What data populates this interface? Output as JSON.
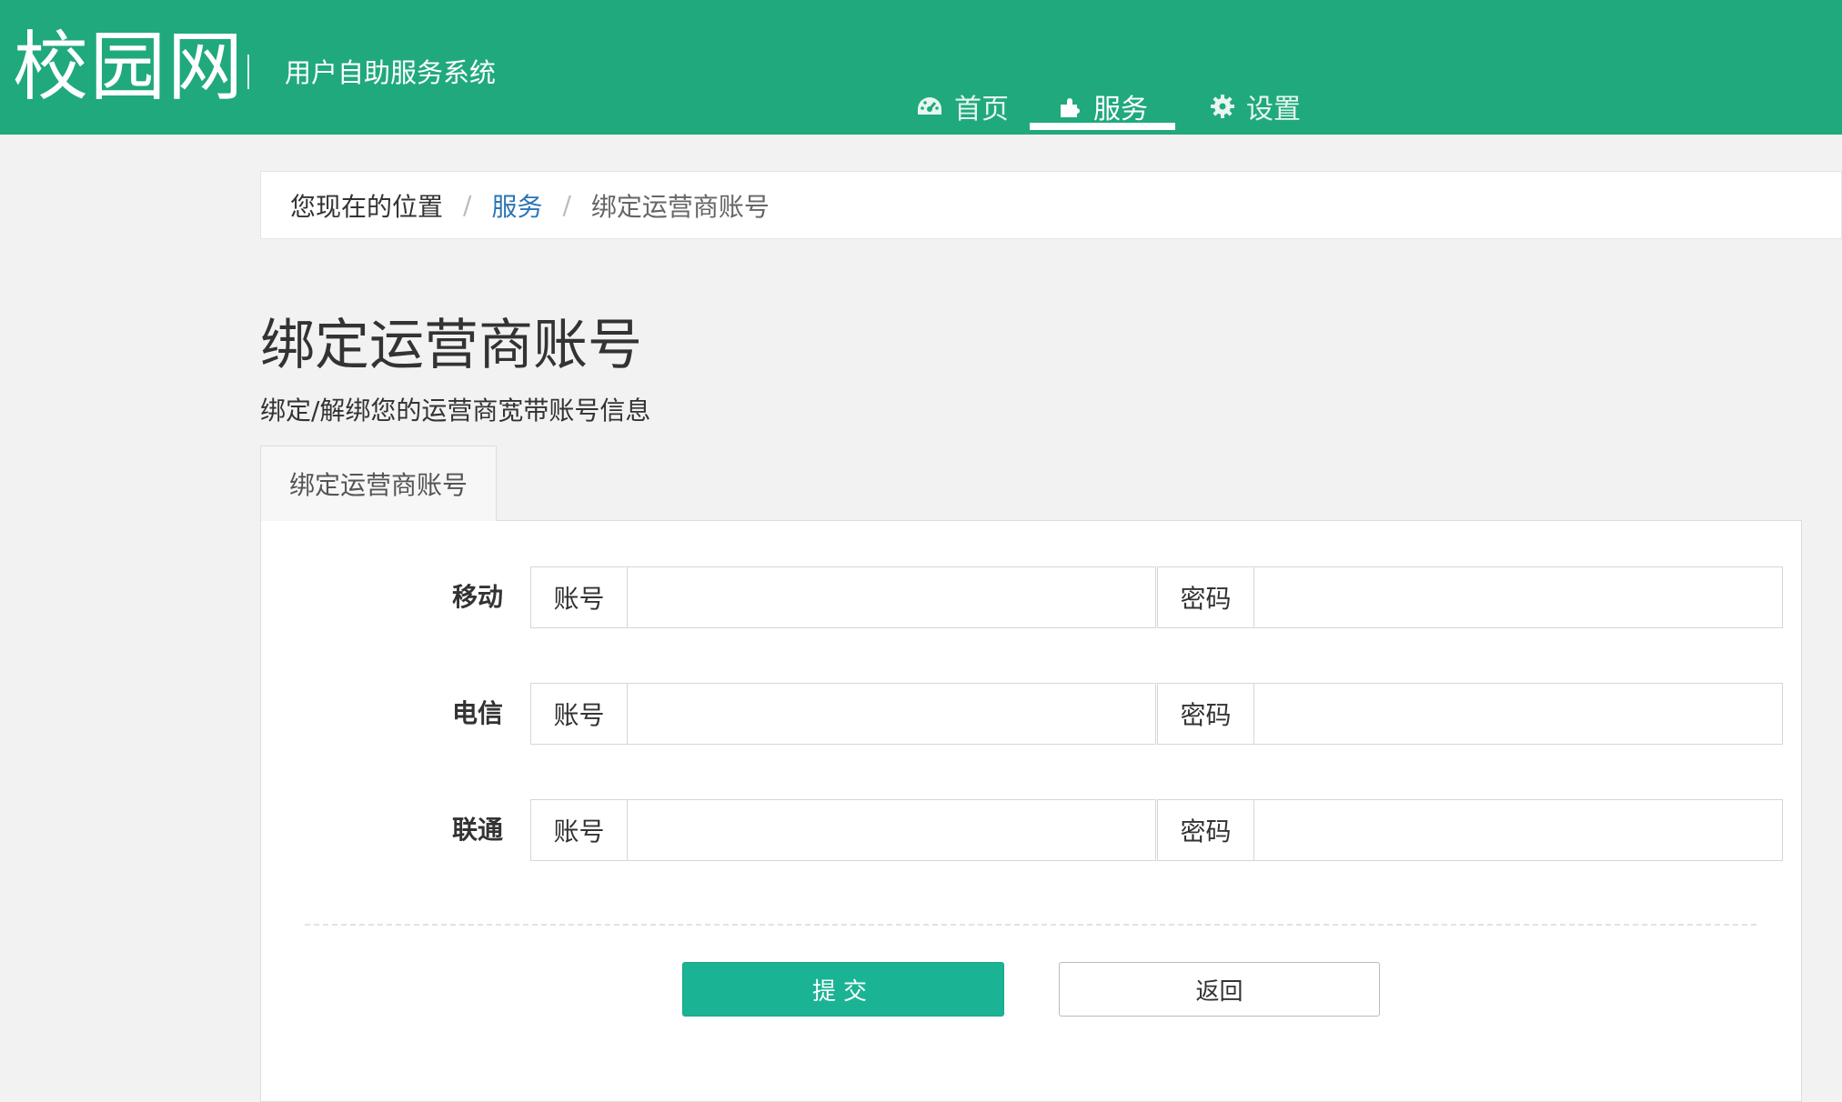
{
  "header": {
    "logo": "校园网",
    "subtitle": "用户自助服务系统",
    "nav": [
      {
        "label": "首页",
        "icon": "dashboard-icon"
      },
      {
        "label": "服务",
        "icon": "puzzle-icon"
      },
      {
        "label": "设置",
        "icon": "gear-icon"
      }
    ],
    "active_nav": "服务",
    "colors": {
      "header_bg": "#20a97d",
      "primary_button": "#1ab394",
      "link": "#2a74b5"
    }
  },
  "breadcrumb": {
    "prefix": "您现在的位置",
    "separator": "/",
    "link": "服务",
    "current": "绑定运营商账号"
  },
  "page": {
    "title": "绑定运营商账号",
    "description": "绑定/解绑您的运营商宽带账号信息"
  },
  "tab": {
    "label": "绑定运营商账号"
  },
  "form": {
    "rows": [
      {
        "label": "移动",
        "account_addon": "账号",
        "password_addon": "密码",
        "account_value": "",
        "password_value": ""
      },
      {
        "label": "电信",
        "account_addon": "账号",
        "password_addon": "密码",
        "account_value": "",
        "password_value": ""
      },
      {
        "label": "联通",
        "account_addon": "账号",
        "password_addon": "密码",
        "account_value": "",
        "password_value": ""
      }
    ],
    "submit_label": "提交",
    "back_label": "返回"
  }
}
